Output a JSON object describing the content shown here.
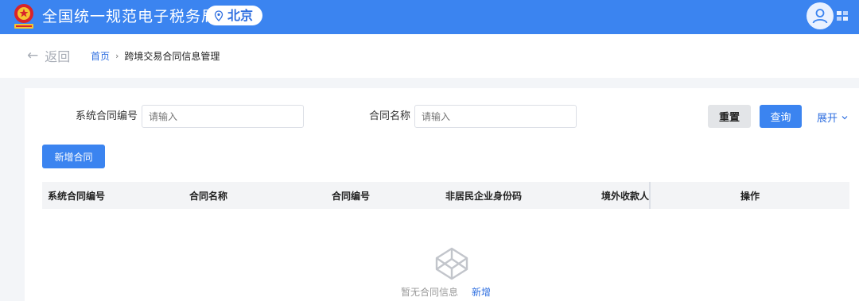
{
  "header": {
    "title": "全国统一规范电子税务局",
    "location": "北京",
    "brand_color": "#3b84f0"
  },
  "nav": {
    "back_label": "返回",
    "breadcrumb_home": "首页",
    "breadcrumb_current": "跨境交易合同信息管理"
  },
  "filters": {
    "contract_sys_no_label": "系统合同编号",
    "contract_sys_no_placeholder": "请输入",
    "contract_name_label": "合同名称",
    "contract_name_placeholder": "请输入",
    "reset_label": "重置",
    "query_label": "查询",
    "expand_label": "展开"
  },
  "toolbar": {
    "add_contract_label": "新增合同"
  },
  "table": {
    "columns": [
      "系统合同编号",
      "合同名称",
      "合同编号",
      "非居民企业身份码",
      "境外收款人",
      "操作"
    ]
  },
  "empty_state": {
    "text": "暂无合同信息",
    "add_label": "新增",
    "icon": "codepen-cube-icon"
  }
}
